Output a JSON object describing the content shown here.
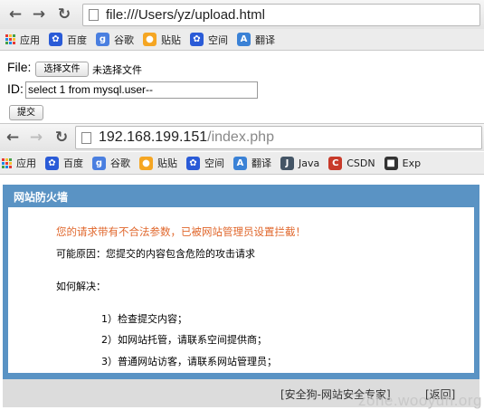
{
  "browser1": {
    "url": "file:///Users/yz/upload.html",
    "bookmarks": [
      {
        "label": "应用",
        "icon": "apps-grid-icon"
      },
      {
        "label": "百度",
        "icon": "baidu-paw-icon"
      },
      {
        "label": "谷歌",
        "icon": "google-g-icon"
      },
      {
        "label": "贴贴",
        "icon": "tieba-bear-icon"
      },
      {
        "label": "空间",
        "icon": "baidu-paw-icon"
      },
      {
        "label": "翻译",
        "icon": "translate-icon"
      }
    ]
  },
  "form": {
    "file_label": "File:",
    "choose_file_button": "选择文件",
    "no_file_text": "未选择文件",
    "id_label": "ID:",
    "id_value": "select 1 from mysql.user--",
    "submit_button": "提交"
  },
  "browser2": {
    "url_host": "192.168.199.151",
    "url_path": "/index.php",
    "bookmarks": [
      {
        "label": "应用",
        "icon": "apps-grid-icon"
      },
      {
        "label": "百度",
        "icon": "baidu-paw-icon"
      },
      {
        "label": "谷歌",
        "icon": "google-g-icon"
      },
      {
        "label": "贴贴",
        "icon": "tieba-bear-icon"
      },
      {
        "label": "空间",
        "icon": "baidu-paw-icon"
      },
      {
        "label": "翻译",
        "icon": "translate-icon"
      },
      {
        "label": "Java",
        "icon": "java-icon"
      },
      {
        "label": "CSDN",
        "icon": "csdn-icon"
      },
      {
        "label": "Exp",
        "icon": "exploit-icon"
      }
    ]
  },
  "waf": {
    "title": "网站防火墙",
    "warning": "您的请求带有不合法参数，已被网站管理员设置拦截！",
    "reason": "可能原因：您提交的内容包含危险的攻击请求",
    "howto": "如何解决：",
    "steps": [
      "1）检查提交内容；",
      "2）如网站托管，请联系空间提供商；",
      "3）普通网站访客，请联系网站管理员；"
    ],
    "footer_link1": "[安全狗-网站安全专家]",
    "footer_link2": "[返回]"
  },
  "watermark": "zone.wooyun.org",
  "colors": {
    "waf_blue": "#5a93c4",
    "warning_orange": "#e0672c",
    "footer_gray": "#dcdcdc"
  }
}
